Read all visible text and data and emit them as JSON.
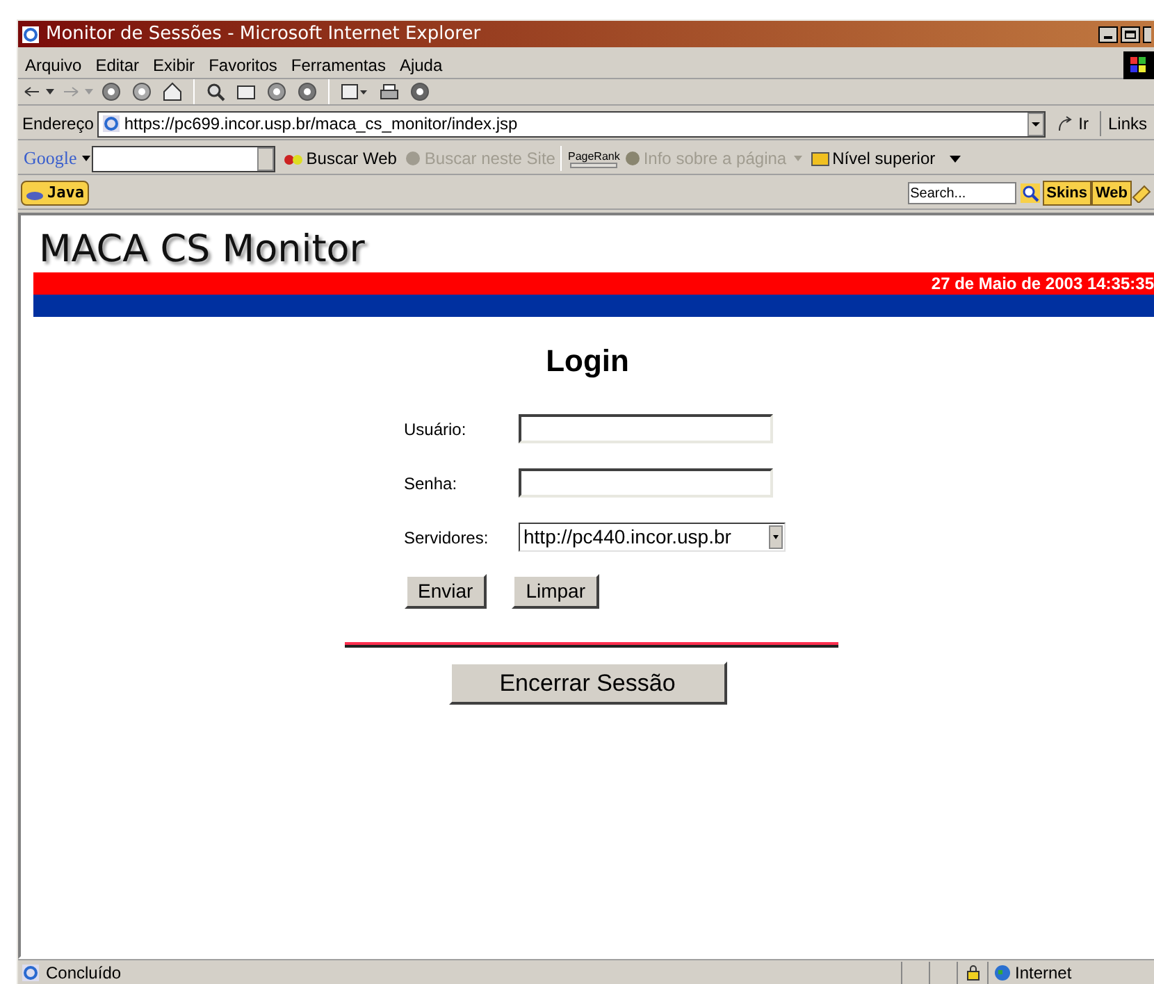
{
  "window": {
    "title": "Monitor de Sessões - Microsoft Internet Explorer"
  },
  "menu": [
    "Arquivo",
    "Editar",
    "Exibir",
    "Favoritos",
    "Ferramentas",
    "Ajuda"
  ],
  "address_bar": {
    "label": "Endereço",
    "value": "https://pc699.incor.usp.br/maca_cs_monitor/index.jsp",
    "go": "Ir",
    "links": "Links"
  },
  "google_bar": {
    "logo": "Google",
    "search_web": "Buscar Web",
    "search_site": "Buscar neste Site",
    "pagerank": "PageRank",
    "info": "Info sobre a página",
    "up": "Nível superior"
  },
  "java_bar": {
    "java": "Java",
    "search_placeholder": "Search...",
    "skins": "Skins",
    "web": "Web"
  },
  "page": {
    "heading": "MACA CS Monitor",
    "date": "27 de Maio de 2003 14:35:35",
    "title": "Login",
    "fields": [
      {
        "label": "Usuário:",
        "kind": "text"
      },
      {
        "label": "Senha:",
        "kind": "password"
      },
      {
        "label": "Servidores:",
        "kind": "select",
        "value": "http://pc440.incor.usp.br"
      }
    ],
    "buttons": [
      "Enviar",
      "Limpar"
    ],
    "end_session": "Encerrar Sessão"
  },
  "status_bar": {
    "text": "Concluído",
    "zone": "Internet"
  }
}
